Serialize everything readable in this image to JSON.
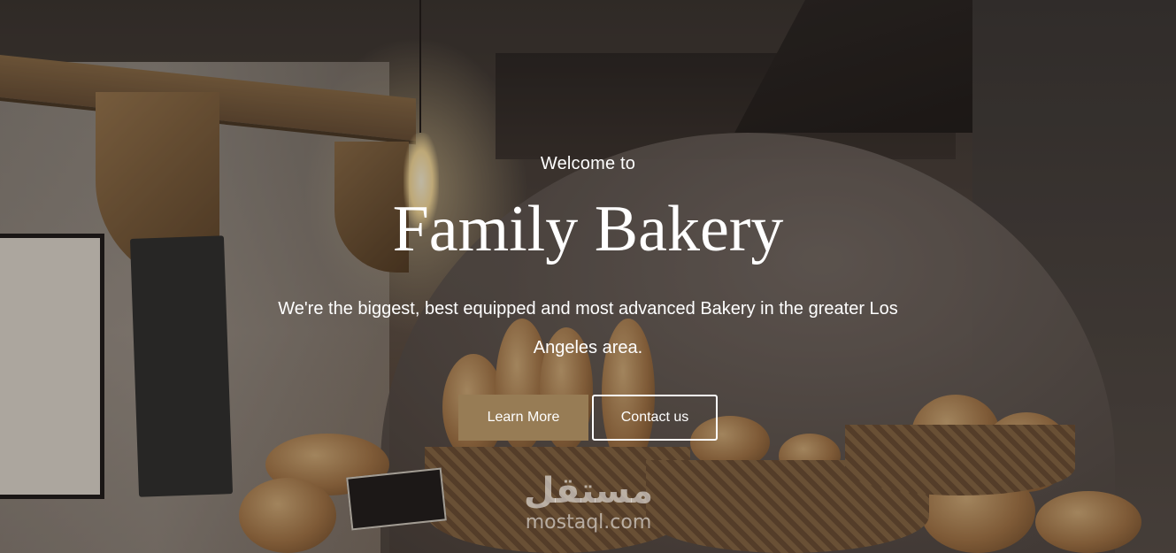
{
  "hero": {
    "welcome": "Welcome to",
    "title": "Family Bakery",
    "subtitle": "We're the biggest, best equipped and most advanced Bakery in the greater Los Angeles area.",
    "buttons": {
      "learn_more": "Learn More",
      "contact_us": "Contact us"
    }
  },
  "watermark": {
    "arabic": "مستقل",
    "latin": "mostaql.com"
  },
  "colors": {
    "primary_button": "#977c55",
    "text": "#ffffff"
  }
}
